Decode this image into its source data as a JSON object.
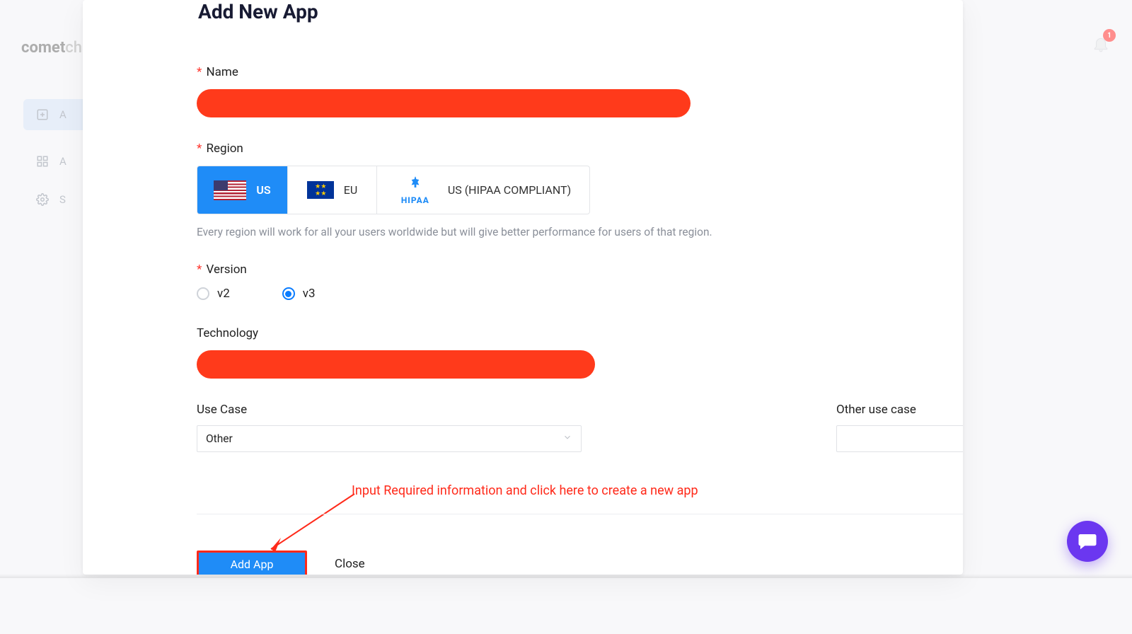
{
  "brand": {
    "part1": "comet",
    "part2": "cha"
  },
  "sidebar": {
    "items": [
      {
        "label": "A"
      },
      {
        "label": "A"
      },
      {
        "label": "S"
      }
    ]
  },
  "bell": {
    "badge": "1"
  },
  "modal": {
    "title": "Add New App",
    "name_label": "Name",
    "region_label": "Region",
    "regions": {
      "us": "US",
      "eu": "EU",
      "hipaa": "US (HIPAA COMPLIANT)",
      "hipaa_logo_text": "HIPAA"
    },
    "region_help": "Every region will work for all your users worldwide but will give better performance for users of that region.",
    "version_label": "Version",
    "versions": {
      "v2": "v2",
      "v3": "v3"
    },
    "technology_label": "Technology",
    "usecase_label": "Use Case",
    "usecase_value": "Other",
    "other_usecase_label": "Other use case",
    "annotation": "Input Required information and click here to create a new app",
    "add_btn": "Add App",
    "close_btn": "Close"
  }
}
